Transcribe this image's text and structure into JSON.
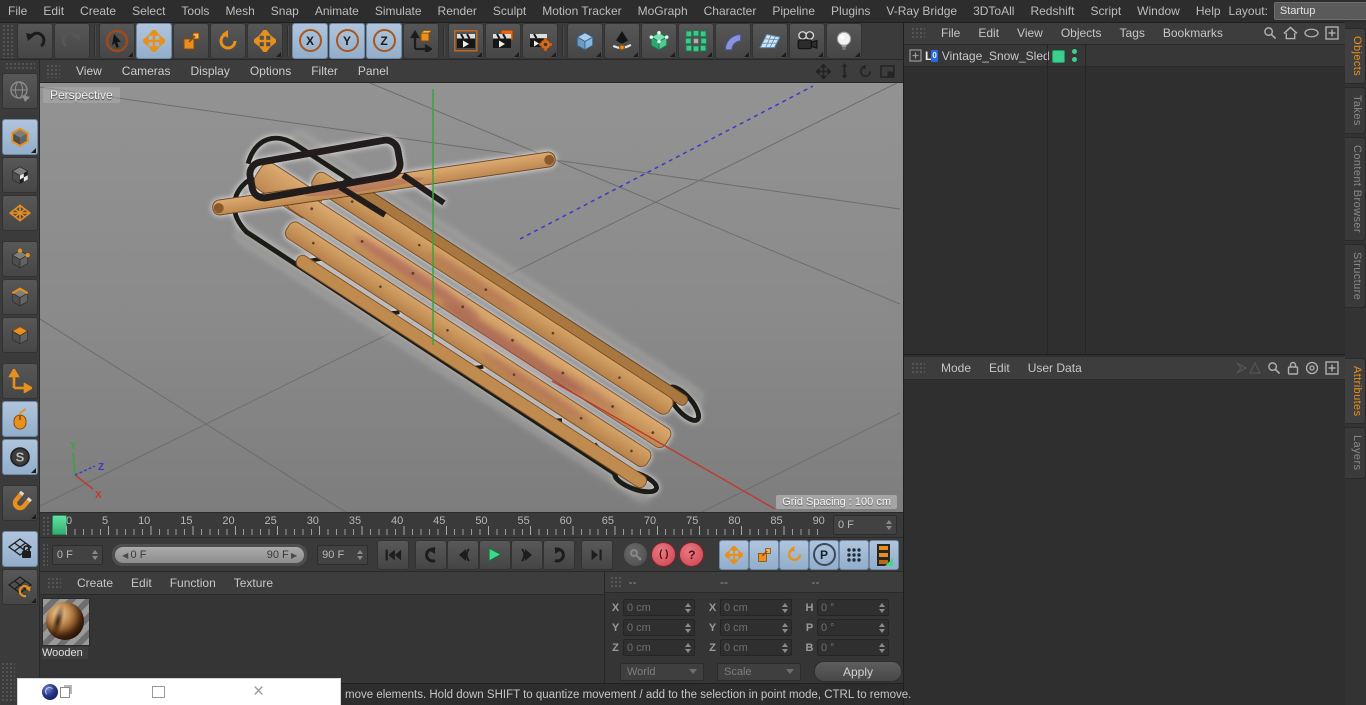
{
  "menubar": {
    "items": [
      "File",
      "Edit",
      "Create",
      "Select",
      "Tools",
      "Mesh",
      "Snap",
      "Animate",
      "Simulate",
      "Render",
      "Sculpt",
      "Motion Tracker",
      "MoGraph",
      "Character",
      "Pipeline",
      "Plugins",
      "V-Ray Bridge",
      "3DToAll",
      "Redshift",
      "Script",
      "Window",
      "Help"
    ],
    "layout_label": "Layout:",
    "layout_value": "Startup"
  },
  "toolbar": {
    "axis_lock_labels": [
      "X",
      "Y",
      "Z"
    ]
  },
  "left_toolbar": {
    "snap_label": "S"
  },
  "viewport": {
    "menu": [
      "View",
      "Cameras",
      "Display",
      "Options",
      "Filter",
      "Panel"
    ],
    "camera_label": "Perspective",
    "grid_spacing_label": "Grid Spacing : 100 cm",
    "axis_x": "X",
    "axis_y": "Y",
    "axis_z": "Z"
  },
  "objects_panel": {
    "menu": [
      "File",
      "Edit",
      "View",
      "Objects",
      "Tags",
      "Bookmarks"
    ],
    "object_name": "Vintage_Snow_Sled",
    "null_icon_label": "L",
    "null_icon_sup": "0"
  },
  "attributes_panel": {
    "menu": [
      "Mode",
      "Edit",
      "User Data"
    ]
  },
  "right_tabs": {
    "top": [
      "Objects",
      "Takes",
      "Content Browser",
      "Structure"
    ],
    "bottom": [
      "Attributes",
      "Layers"
    ]
  },
  "timeline": {
    "ticks": [
      "0",
      "5",
      "10",
      "15",
      "20",
      "25",
      "30",
      "35",
      "40",
      "45",
      "50",
      "55",
      "60",
      "65",
      "70",
      "75",
      "80",
      "85",
      "90"
    ],
    "frame_field_right": "0 F"
  },
  "transport": {
    "current_frame": "0 F",
    "range_start": "0 F",
    "range_end": "90 F",
    "end_frame": "90 F",
    "param_key_label": "P"
  },
  "materials_panel": {
    "menu": [
      "Create",
      "Edit",
      "Function",
      "Texture"
    ],
    "material_name": "Wooden"
  },
  "coordinates_panel": {
    "headers": [
      "--",
      "--",
      "--"
    ],
    "position_rows": [
      {
        "label": "X",
        "value": "0 cm"
      },
      {
        "label": "Y",
        "value": "0 cm"
      },
      {
        "label": "Z",
        "value": "0 cm"
      }
    ],
    "scale_rows": [
      {
        "label": "X",
        "value": "0 cm"
      },
      {
        "label": "Y",
        "value": "0 cm"
      },
      {
        "label": "Z",
        "value": "0 cm"
      }
    ],
    "rotation_rows": [
      {
        "label": "H",
        "value": "0 °"
      },
      {
        "label": "P",
        "value": "0 °"
      },
      {
        "label": "B",
        "value": "0 °"
      }
    ],
    "system_dropdown": "World",
    "mode_dropdown": "Scale",
    "apply_button": "Apply"
  },
  "status_bar": {
    "text": "move elements. Hold down SHIFT to quantize movement / add to the selection in point mode, CTRL to remove."
  },
  "colors": {
    "accent_orange": "#e8901c",
    "selection_blue": "#9cb7d4",
    "c4d_green": "#3ccf8e",
    "autokey_red": "#d9565e",
    "axis_x": "#c03a2e",
    "axis_y": "#3aa53a",
    "axis_z": "#3a3ac8",
    "wood": "#c9975f"
  }
}
